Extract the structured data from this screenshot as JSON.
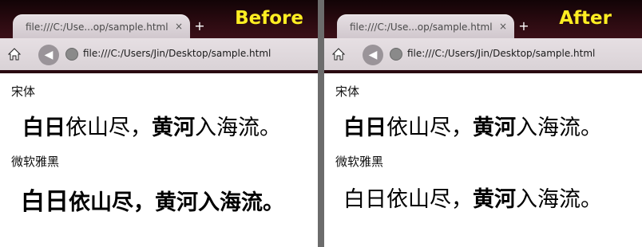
{
  "browser": {
    "tab_title": "file:///C:/Use...op/sample.html",
    "tab_close": "×",
    "new_tab": "+",
    "url": "file:///C:/Users/Jin/Desktop/sample.html",
    "back": "◀"
  },
  "panels": {
    "left": {
      "label": "Before",
      "font_label_1": "宋体",
      "font_label_2": "微软雅黑",
      "line1": {
        "bold_a": "白日",
        "normal_a": "依山尽，",
        "bold_b": "黄河",
        "normal_b": "入海流。"
      },
      "line2": {
        "bold_a": "白日",
        "normal_a": "依山尽，",
        "bold_b": "黄河",
        "normal_b": "入海流。"
      }
    },
    "right": {
      "label": "After",
      "font_label_1": "宋体",
      "font_label_2": "微软雅黑",
      "line1": {
        "bold_a": "白日",
        "normal_a": "依山尽，",
        "bold_b": "黄河",
        "normal_b": "入海流。"
      },
      "line2": {
        "bold_a": "白日",
        "normal_a": "依山尽，",
        "bold_b": "黄河",
        "normal_b": "入海流。"
      }
    }
  },
  "colors": {
    "label_yellow": "#ffee22",
    "titlebar_dark": "#2a0a10",
    "tab_bg": "#e6dfe3"
  }
}
